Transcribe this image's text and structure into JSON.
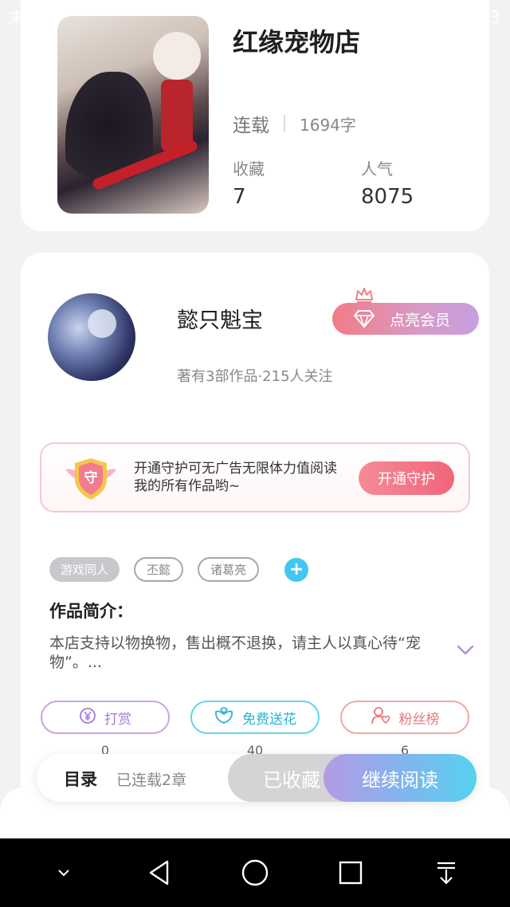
{
  "status_bar": {
    "carrier": "未插卡",
    "battery": "97%",
    "battery_level": 0.97,
    "time": "22:03",
    "icons": [
      "mute-icon",
      "wifi-icon",
      "sim-icon",
      "sim-icon",
      "battery-icon"
    ]
  },
  "book": {
    "title": "红缘宠物店",
    "status": "连载",
    "word_count": "1694字",
    "favorites_label": "收藏",
    "favorites_value": "7",
    "popularity_label": "人气",
    "popularity_value": "8075"
  },
  "author": {
    "name": "懿只魁宝",
    "info": "著有3部作品·215人关注",
    "vip_button": "点亮会员"
  },
  "guard": {
    "badge": "守",
    "text": "开通守护可无广告无限体力值阅读我的所有作品哟~",
    "button": "开通守护"
  },
  "tags": [
    "游戏同人",
    "丕懿",
    "诸葛亮"
  ],
  "intro": {
    "title": "作品简介：",
    "text": "本店支持以物换物，售出概不退换，请主人以真心待“宠物”。..."
  },
  "actions": [
    {
      "label": "打赏",
      "count": "0",
      "icon": "yen-icon"
    },
    {
      "label": "免费送花",
      "count": "40",
      "icon": "flower-icon"
    },
    {
      "label": "粉丝榜",
      "count": "6",
      "icon": "fans-icon"
    }
  ],
  "bottom_bar": {
    "toc": "目录",
    "chapters": "已连载2章",
    "collected": "已收藏",
    "continue": "继续阅读"
  },
  "colors": {
    "accent_purple": "#b49ae6",
    "accent_cyan": "#56d2ef",
    "accent_pink": "#f0657b"
  }
}
